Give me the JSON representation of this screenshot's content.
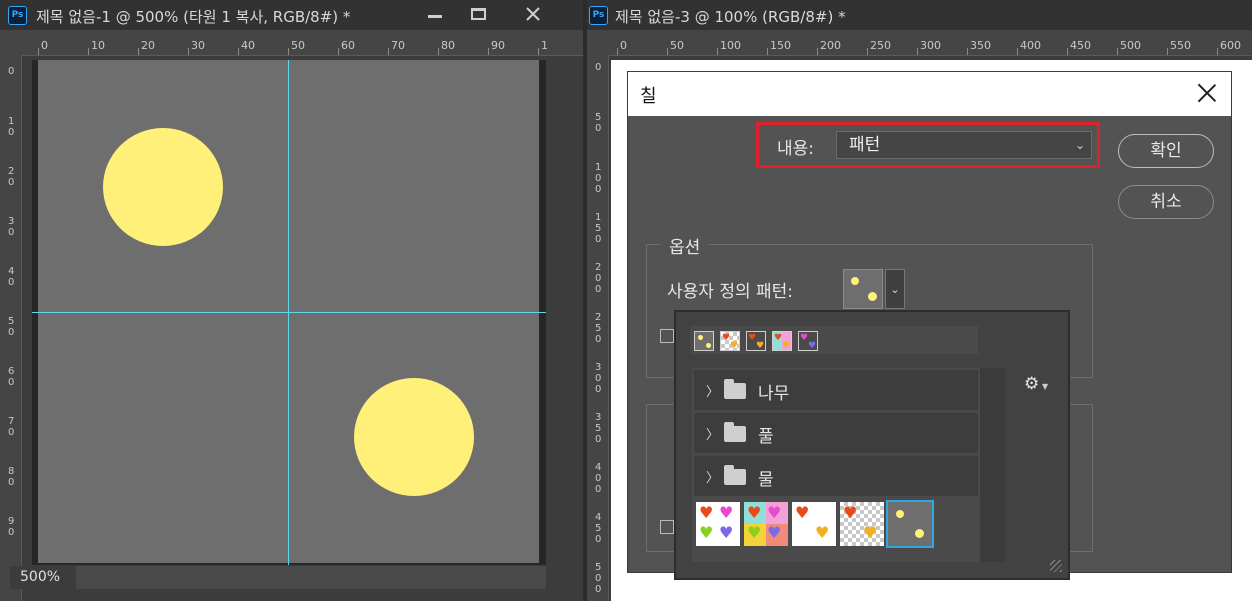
{
  "left_window": {
    "title": "제목 없음-1 @ 500% (타원 1 복사, RGB/8#) *",
    "app_icon": "Ps",
    "minimize_icon": "minimize-icon",
    "maximize_icon": "maximize-icon",
    "close_icon": "close-icon",
    "ruler_h": [
      "0",
      "10",
      "20",
      "30",
      "40",
      "50",
      "60",
      "70",
      "80",
      "90",
      "1"
    ],
    "ruler_v": [
      "0",
      "1\n0",
      "2\n0",
      "3\n0",
      "4\n0",
      "5\n0",
      "6\n0",
      "7\n0",
      "8\n0",
      "9\n0"
    ],
    "zoom": "500%"
  },
  "right_window": {
    "title": "제목 없음-3 @ 100% (RGB/8#) *",
    "app_icon": "Ps",
    "ruler_h": [
      "0",
      "50",
      "100",
      "150",
      "200",
      "250",
      "300",
      "350",
      "400",
      "450",
      "500",
      "550",
      "600"
    ],
    "ruler_v": [
      "0",
      "5\n0",
      "1\n0\n0",
      "1\n5\n0",
      "2\n0\n0",
      "2\n5\n0",
      "3\n0\n0",
      "3\n5\n0",
      "4\n0\n0",
      "4\n5\n0",
      "5\n0\n0"
    ]
  },
  "dialog": {
    "title": "칠",
    "content_label": "내용:",
    "content_value": "패턴",
    "ok_label": "확인",
    "cancel_label": "취소",
    "options_title": "옵션",
    "custom_pattern_label": "사용자 정의 패턴:"
  },
  "pattern_picker": {
    "folders": [
      "나무",
      "풀",
      "물"
    ],
    "settings_icon": "gear-icon",
    "selected_index": 4
  },
  "colors": {
    "accent": "#2fa6e6",
    "highlight": "#e0202a",
    "guide": "#5fd8e8",
    "circle": "#fff07a"
  }
}
